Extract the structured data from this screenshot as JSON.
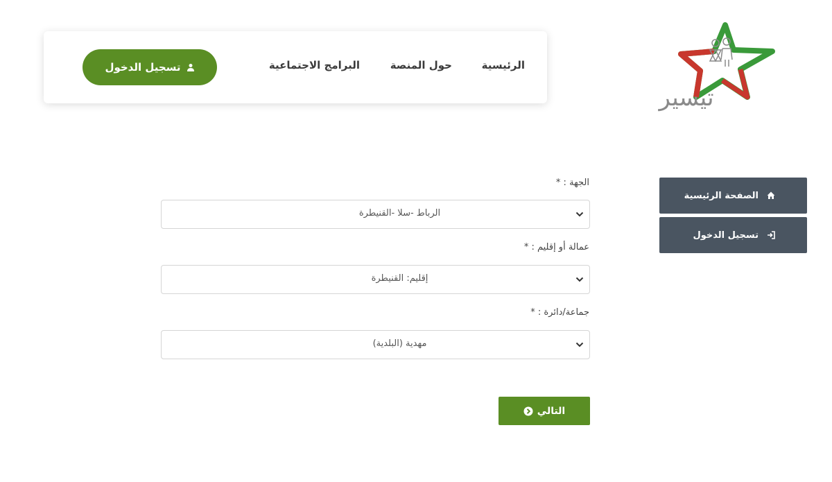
{
  "nav": {
    "home": "الرئيسية",
    "about": "حول المنصة",
    "programs": "البرامج الاجتماعية",
    "login": "تسجيل الدخول"
  },
  "logo": {
    "text": "تيسير",
    "colors": {
      "green": "#3a9a3a",
      "red": "#c8372d",
      "grey": "#8a8a8a"
    }
  },
  "side_menu": {
    "home": {
      "label": "الصفحة الرئيسية",
      "icon": "home-icon"
    },
    "login": {
      "label": "تسجيل الدخول",
      "icon": "sign-in-icon"
    }
  },
  "form": {
    "region": {
      "label": "الجهة : *",
      "value": "الرباط -سلا -القنيطرة"
    },
    "province": {
      "label": "عمالة أو إقليم : *",
      "value": "إقليم: القنيطرة"
    },
    "commune": {
      "label": "جماعة/دائرة : *",
      "value": "مهدية (البلدية)"
    },
    "next": "التالي"
  },
  "colors": {
    "accent": "#5a8e24",
    "sidebar": "#4a5561",
    "text": "#3b3b3b"
  }
}
